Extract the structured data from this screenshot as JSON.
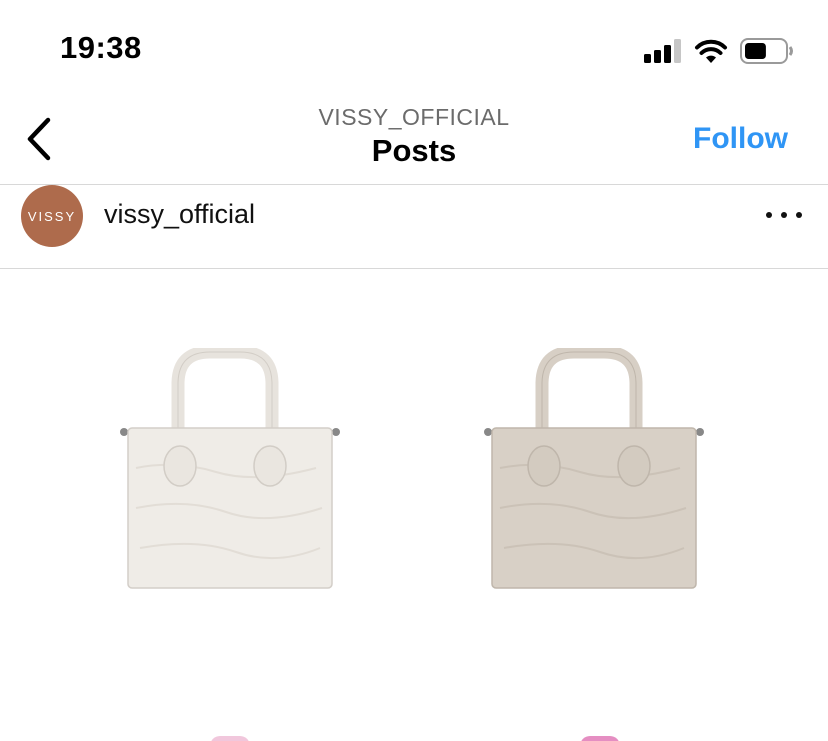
{
  "status_bar": {
    "time": "19:38",
    "battery_level": 0.55
  },
  "nav": {
    "username": "VISSY_OFFICIAL",
    "title": "Posts",
    "follow_label": "Follow",
    "follow_color": "#2f95f5"
  },
  "post": {
    "username": "vissy_official",
    "avatar_text": "VISSY",
    "avatar_color": "#ae6b4c",
    "bags": [
      {
        "name": "white-croc-handbag",
        "color": "#efece7"
      },
      {
        "name": "taupe-croc-handbag",
        "color": "#d8d0c6"
      }
    ]
  }
}
